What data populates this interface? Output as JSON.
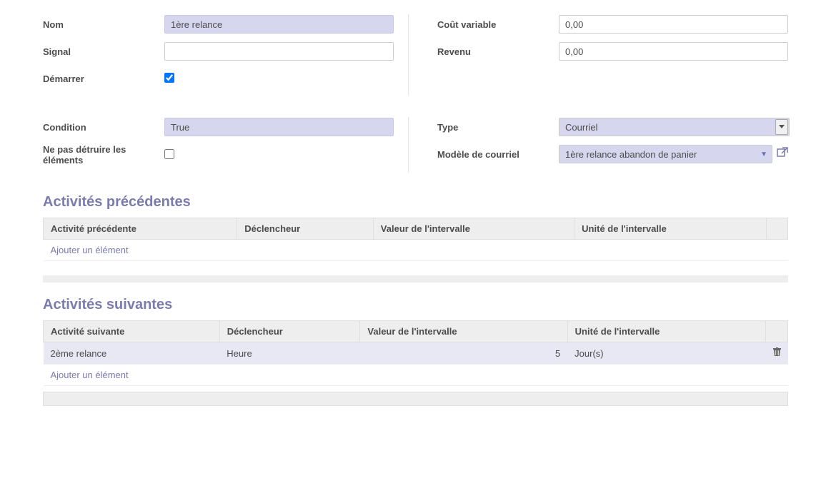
{
  "labels": {
    "nom": "Nom",
    "signal": "Signal",
    "demarrer": "Démarrer",
    "cout_variable": "Coût variable",
    "revenu": "Revenu",
    "condition": "Condition",
    "ne_pas_detruire": "Ne pas détruire les éléments",
    "type": "Type",
    "modele_courriel": "Modèle de courriel"
  },
  "values": {
    "nom": "1ère relance",
    "signal": "",
    "demarrer_checked": true,
    "cout_variable": "0,00",
    "revenu": "0,00",
    "condition": "True",
    "ne_pas_detruire_checked": false,
    "type": "Courriel",
    "modele_courriel": "1ère relance abandon de panier"
  },
  "sections": {
    "precedentes": {
      "title": "Activités précédentes",
      "headers": {
        "activite": "Activité précédente",
        "declencheur": "Déclencheur",
        "valeur": "Valeur de l'intervalle",
        "unite": "Unité de l'intervalle"
      },
      "add": "Ajouter un élément",
      "rows": []
    },
    "suivantes": {
      "title": "Activités suivantes",
      "headers": {
        "activite": "Activité suivante",
        "declencheur": "Déclencheur",
        "valeur": "Valeur de l'intervalle",
        "unite": "Unité de l'intervalle"
      },
      "add": "Ajouter un élément",
      "rows": [
        {
          "activite": "2ème relance",
          "declencheur": "Heure",
          "valeur": "5",
          "unite": "Jour(s)"
        }
      ]
    }
  }
}
